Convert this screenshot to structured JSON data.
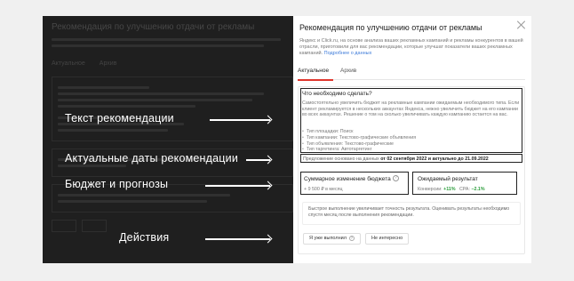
{
  "annotations": {
    "text": "Текст рекомендации",
    "dates": "Актуальные даты рекомендации",
    "budget": "Бюджет и прогнозы",
    "actions": "Действия"
  },
  "panel": {
    "title": "Рекомендация по улучшению отдачи от рекламы",
    "description": "Яндекс и Click.ru, на основе анализа ваших рекламных кампаний и рекламы конкурентов в вашей отрасли, приготовили для вас рекомендации, которые улучшат показатели ваших рекламных кампаний.",
    "more_link": "Подробнее о данных",
    "tabs": [
      "Актуальное",
      "Архив"
    ]
  },
  "recommendation": {
    "question": "Что необходимо сделать?",
    "text": "Самостоятельно увеличить бюджет на рекламные кампании ожидаемым необходимого типа. Если клиент рекламируется в нескольких аккаунтах Яндекса, нежно увеличить бюджет на его кампании во всех аккаунтах. Решение о том на сколько увеличивать каждую кампанию остается на вас.",
    "items": [
      "Тип площадки: Поиск",
      "Тип кампании: Текстово-графические объявления",
      "Тип объявления: Текстово-графические",
      "Тип таргетинга: Автотаргетинг"
    ],
    "dates_prefix": "Предложение основано на данных",
    "dates_value": "от 02 сентября 2022 и актуально до 21.09.2022"
  },
  "budget": {
    "title": "Суммарное изменение бюджета",
    "value": "+ 9 500 ₽ в месяц",
    "forecast_title": "Ожидаемый результат",
    "conv_label": "Конверсии:",
    "conv_value": "+11%",
    "cpa_label": "CPA:",
    "cpa_value": "−2.1%"
  },
  "speed_note": "Быстрое выполнение увеличивает точность результата. Оценивать результаты необходимо спустя месяц после выполнения рекомендации.",
  "actions": {
    "done": "Я уже выполнил",
    "not_interested": "Не интересно"
  }
}
